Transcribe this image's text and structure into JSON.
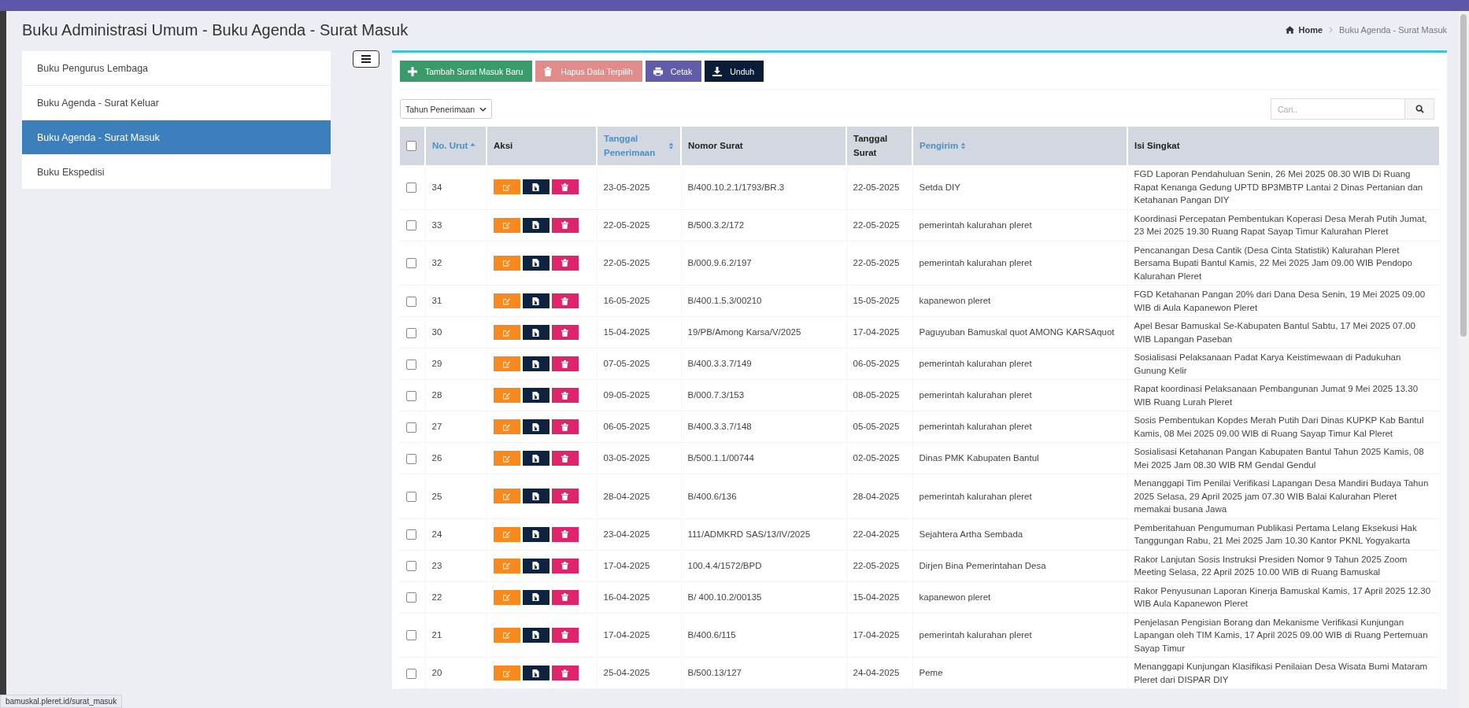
{
  "page_title": "Buku Administrasi Umum - Buku Agenda - Surat Masuk",
  "breadcrumb": [
    {
      "label": "Home",
      "kind": "home"
    },
    {
      "label": "Buku Agenda - Surat Masuk",
      "kind": "current"
    }
  ],
  "sidebar": {
    "items": [
      {
        "label": "Buku Pengurus Lembaga",
        "selected": false
      },
      {
        "label": "Buku Agenda - Surat Keluar",
        "selected": false
      },
      {
        "label": "Buku Agenda - Surat Masuk",
        "selected": true
      },
      {
        "label": "Buku Ekspedisi",
        "selected": false
      }
    ]
  },
  "toolbar": [
    {
      "label": "Tambah Surat Masuk Baru",
      "kind": "add",
      "disabled": false
    },
    {
      "label": "Hapus Data Terpilih",
      "kind": "delete",
      "disabled": true
    },
    {
      "label": "Cetak",
      "kind": "print",
      "disabled": false
    },
    {
      "label": "Unduh",
      "kind": "download",
      "disabled": false
    }
  ],
  "filter": {
    "value": "Tahun Penerimaan"
  },
  "search": {
    "placeholder": "Cari.."
  },
  "table": {
    "select_all": {
      "checked": false
    },
    "columns": [
      {
        "label": "No. Urut",
        "sortable": true,
        "sorted": true
      },
      {
        "label": "Aksi",
        "sortable": false
      },
      {
        "label": "Tanggal Penerimaan",
        "sortable": true,
        "sorted": false
      },
      {
        "label": "Nomor Surat",
        "sortable": false
      },
      {
        "label": "Tanggal Surat",
        "sortable": false
      },
      {
        "label": "Pengirim",
        "sortable": true,
        "sorted": false
      },
      {
        "label": "Isi Singkat",
        "sortable": false
      }
    ],
    "rows": [
      {
        "checked": false,
        "no": "34",
        "received": "23-05-2025",
        "number": "B/400.10.2.1/1793/BR.3",
        "date": "22-05-2025",
        "sender": "Setda DIY",
        "summary": "FGD Laporan Pendahuluan Senin, 26 Mei 2025 08.30 WIB Di Ruang Rapat Kenanga Gedung UPTD BP3MBTP Lantai 2 Dinas Pertanian dan Ketahanan Pangan DIY"
      },
      {
        "checked": false,
        "no": "33",
        "received": "22-05-2025",
        "number": "B/500.3.2/172",
        "date": "22-05-2025",
        "sender": "pemerintah kalurahan pleret",
        "summary": "Koordinasi Percepatan Pembentukan Koperasi Desa Merah Putih Jumat, 23 Mei 2025 19.30 Ruang Rapat Sayap Timur Kalurahan Pleret"
      },
      {
        "checked": false,
        "no": "32",
        "received": "22-05-2025",
        "number": "B/000.9.6.2/197",
        "date": "22-05-2025",
        "sender": "pemerintah kalurahan pleret",
        "summary": "Pencanangan Desa Cantik (Desa Cinta Statistik) Kalurahan Pleret Bersama Bupati Bantul Kamis, 22 Mei 2025 Jam 09.00 WIB Pendopo Kalurahan Pleret"
      },
      {
        "checked": false,
        "no": "31",
        "received": "16-05-2025",
        "number": "B/400.1.5.3/00210",
        "date": "15-05-2025",
        "sender": "kapanewon pleret",
        "summary": "FGD Ketahanan Pangan 20% dari Dana Desa Senin, 19 Mei 2025 09.00 WIB di Aula Kapanewon Pleret"
      },
      {
        "checked": false,
        "no": "30",
        "received": "15-04-2025",
        "number": "19/PB/Among Karsa/V/2025",
        "date": "17-04-2025",
        "sender": "Paguyuban Bamuskal quot AMONG KARSAquot",
        "summary": "Apel Besar Bamuskal Se-Kabupaten Bantul Sabtu, 17 Mei 2025 07.00 WIB Lapangan Paseban"
      },
      {
        "checked": false,
        "no": "29",
        "received": "07-05-2025",
        "number": "B/400.3.3.7/149",
        "date": "06-05-2025",
        "sender": "pemerintah kalurahan pleret",
        "summary": "Sosialisasi Pelaksanaan Padat Karya Keistimewaan di Padukuhan Gunung Kelir"
      },
      {
        "checked": false,
        "no": "28",
        "received": "09-05-2025",
        "number": "B/000.7.3/153",
        "date": "08-05-2025",
        "sender": "pemerintah kalurahan pleret",
        "summary": "Rapat koordinasi Pelaksanaan Pembangunan Jumat 9 Mei 2025 13.30 WIB Ruang Lurah Pleret"
      },
      {
        "checked": false,
        "no": "27",
        "received": "06-05-2025",
        "number": "B/400.3.3.7/148",
        "date": "05-05-2025",
        "sender": "pemerintah kalurahan pleret",
        "summary": "Sosis Pembentukan Kopdes Merah Putih Dari Dinas KUPKP Kab Bantul Kamis, 08 Mei 2025 09.00 WIB di Ruang Sayap Timur Kal Pleret"
      },
      {
        "checked": false,
        "no": "26",
        "received": "03-05-2025",
        "number": "B/500.1.1/00744",
        "date": "02-05-2025",
        "sender": "Dinas PMK Kabupaten Bantul",
        "summary": "Sosialisasi Ketahanan Pangan Kabupaten Bantul Tahun 2025 Kamis, 08 Mei 2025 Jam 08.30 WIB RM Gendal Gendul"
      },
      {
        "checked": false,
        "no": "25",
        "received": "28-04-2025",
        "number": "B/400.6/136",
        "date": "28-04-2025",
        "sender": "pemerintah kalurahan pleret",
        "summary": "Menanggapi Tim Penilai Verifikasi Lapangan Desa Mandiri Budaya Tahun 2025 Selasa, 29 April 2025 jam 07.30 WIB Balai Kalurahan Pleret memakai busana Jawa"
      },
      {
        "checked": false,
        "no": "24",
        "received": "23-04-2025",
        "number": "111/ADMKRD SAS/13/IV/2025",
        "date": "22-04-2025",
        "sender": "Sejahtera Artha Sembada",
        "summary": "Pemberitahuan Pengumuman Publikasi Pertama Lelang Eksekusi Hak Tanggungan Rabu, 21 Mei 2025 Jam 10.30 Kantor PKNL Yogyakarta"
      },
      {
        "checked": false,
        "no": "23",
        "received": "17-04-2025",
        "number": "100.4.4/1572/BPD",
        "date": "22-05-2025",
        "sender": "Dirjen Bina Pemerintahan Desa",
        "summary": "Rakor Lanjutan Sosis Instruksi Presiden Nomor 9 Tahun 2025 Zoom Meeting Selasa, 22 April 2025 10.00 WIB di Ruang Bamuskal"
      },
      {
        "checked": false,
        "no": "22",
        "received": "16-04-2025",
        "number": "B/ 400.10.2/00135",
        "date": "15-04-2025",
        "sender": "kapanewon pleret",
        "summary": "Rakor Penyusunan Laporan Kinerja Bamuskal Kamis, 17 April 2025 12.30 WIB Aula Kapanewon Pleret"
      },
      {
        "checked": false,
        "no": "21",
        "received": "17-04-2025",
        "number": "B/400.6/115",
        "date": "17-04-2025",
        "sender": "pemerintah kalurahan pleret",
        "summary": "Penjelasan Pengisian Borang dan Mekanisme Verifikasi Kunjungan Lapangan oleh TIM Kamis, 17 April 2025 09.00 WIB di Ruang Pertemuan Sayap Timur"
      },
      {
        "checked": false,
        "no": "20",
        "received": "25-04-2025",
        "number": "B/500.13/127",
        "date": "24-04-2025",
        "sender": "Peme",
        "summary": "Menanggapi Kunjungan Klasifikasi Penilaian Desa Wisata Bumi Mataram Pleret dari DISPAR DIY"
      }
    ]
  },
  "status_bar": {
    "url": "bamuskal.pleret.id/surat_masuk"
  }
}
